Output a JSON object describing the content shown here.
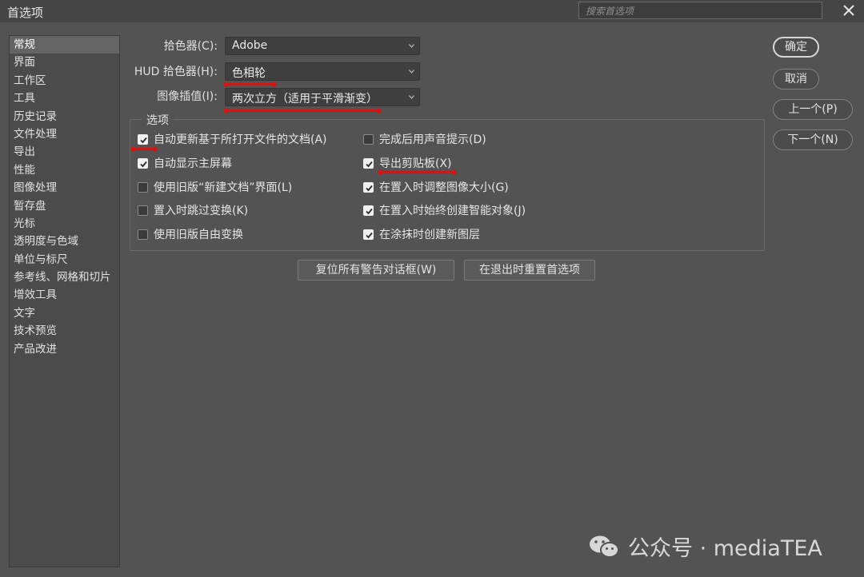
{
  "window": {
    "title": "首选项",
    "search_placeholder": "搜索首选项"
  },
  "sidebar": {
    "items": [
      {
        "label": "常规"
      },
      {
        "label": "界面"
      },
      {
        "label": "工作区"
      },
      {
        "label": "工具"
      },
      {
        "label": "历史记录"
      },
      {
        "label": "文件处理"
      },
      {
        "label": "导出"
      },
      {
        "label": "性能"
      },
      {
        "label": "图像处理"
      },
      {
        "label": "暂存盘"
      },
      {
        "label": "光标"
      },
      {
        "label": "透明度与色域"
      },
      {
        "label": "单位与标尺"
      },
      {
        "label": "参考线、网格和切片"
      },
      {
        "label": "增效工具"
      },
      {
        "label": "文字"
      },
      {
        "label": "技术预览"
      },
      {
        "label": "产品改进"
      }
    ],
    "selected": "常规"
  },
  "fields": {
    "color_picker": {
      "label": "拾色器(C):",
      "value": "Adobe"
    },
    "hud_color_picker": {
      "label": "HUD 拾色器(H):",
      "value": "色相轮"
    },
    "image_interpolation": {
      "label": "图像插值(I):",
      "value": "两次立方（适用于平滑渐变）"
    }
  },
  "options": {
    "legend": "选项",
    "left": [
      {
        "label": "自动更新基于所打开文件的文档(A)",
        "checked": true
      },
      {
        "label": "自动显示主屏幕",
        "checked": true
      },
      {
        "label": "使用旧版“新建文档”界面(L)",
        "checked": false
      },
      {
        "label": "置入时跳过变换(K)",
        "checked": false
      },
      {
        "label": "使用旧版自由变换",
        "checked": false
      }
    ],
    "right": [
      {
        "label": "完成后用声音提示(D)",
        "checked": false
      },
      {
        "label": "导出剪贴板(X)",
        "checked": true
      },
      {
        "label": "在置入时调整图像大小(G)",
        "checked": true
      },
      {
        "label": "在置入时始终创建智能对象(J)",
        "checked": true
      },
      {
        "label": "在涂抹时创建新图层",
        "checked": true
      }
    ]
  },
  "actions": {
    "reset_warnings": "复位所有警告对话框(W)",
    "reset_on_quit": "在退出时重置首选项"
  },
  "dialog_buttons": {
    "ok": "确定",
    "cancel": "取消",
    "prev": "上一个(P)",
    "next": "下一个(N)"
  },
  "watermark": {
    "text": "公众号 · mediaTEA"
  },
  "colors": {
    "background": "#535353",
    "annotation_red": "#e01010"
  },
  "icons": [
    "close-icon",
    "chevron-down-icon",
    "checkmark-icon",
    "wechat-logo-icon"
  ]
}
